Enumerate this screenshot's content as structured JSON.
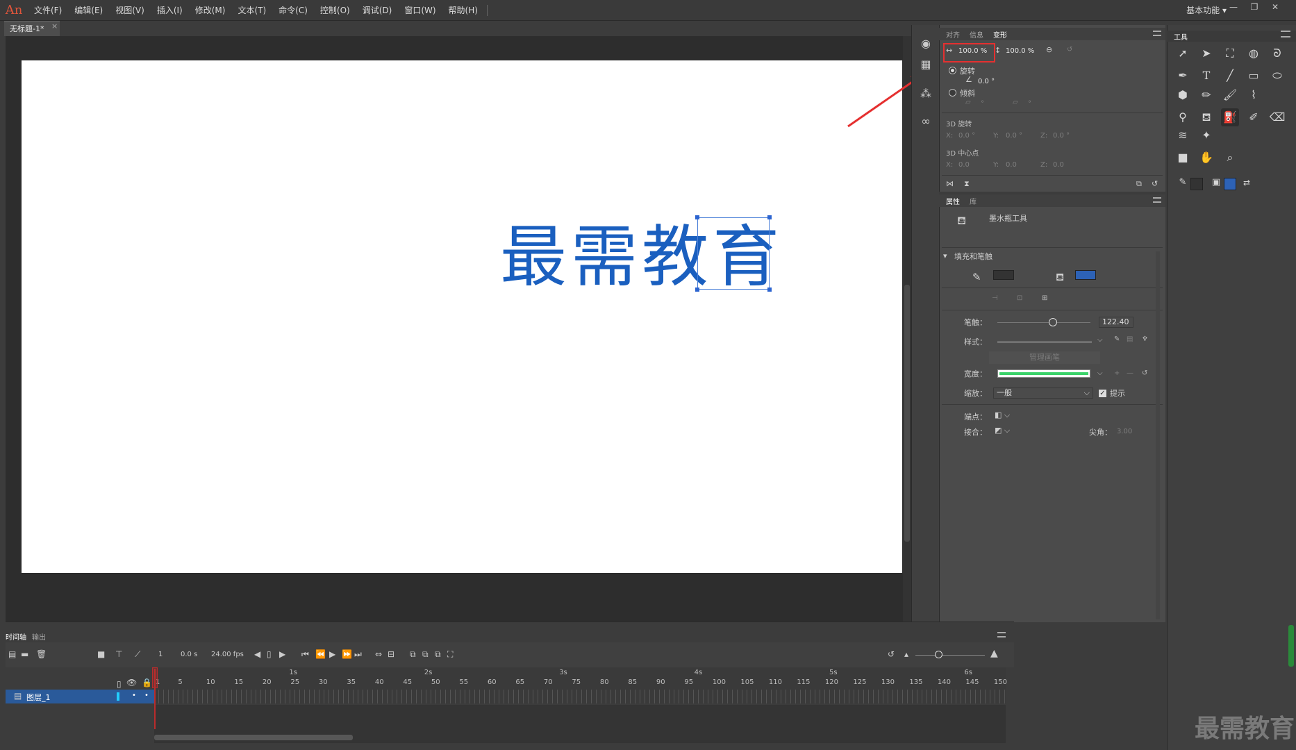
{
  "app": {
    "logo": "An",
    "workspace": "基本功能"
  },
  "menu": {
    "items": [
      "文件(F)",
      "编辑(E)",
      "视图(V)",
      "插入(I)",
      "修改(M)",
      "文本(T)",
      "命令(C)",
      "控制(O)",
      "调试(D)",
      "窗口(W)",
      "帮助(H)"
    ]
  },
  "document": {
    "tab_title": "无标题-1*",
    "close": "×"
  },
  "stage": {
    "text": "最需教育",
    "text_color": "#1a5fbf"
  },
  "transform_panel": {
    "tabs": [
      "对齐",
      "信息",
      "变形"
    ],
    "width_pct": "100.0 %",
    "height_pct": "100.0 %",
    "rotate_label": "旋转",
    "rotate_value": "0.0 °",
    "skew_label": "倾斜",
    "skew_x": "°",
    "skew_y": "°",
    "rotate3d_label": "3D 旋转",
    "rotate3d": {
      "x_label": "X:",
      "x": "0.0 °",
      "y_label": "Y:",
      "y": "0.0 °",
      "z_label": "Z:",
      "z": "0.0 °"
    },
    "center3d_label": "3D 中心点",
    "center3d": {
      "x_label": "X:",
      "x": "0.0",
      "y_label": "Y:",
      "y": "0.0",
      "z_label": "Z:",
      "z": "0.0"
    }
  },
  "properties_panel": {
    "tabs": [
      "属性",
      "库"
    ],
    "tool_name": "墨水瓶工具",
    "section": "填充和笔触",
    "stroke_color": "#333333",
    "fill_color": "#2d62b6",
    "stroke_label": "笔触：",
    "stroke_value": "122.40",
    "style_label": "样式：",
    "manage_brush": "管理画笔",
    "width_label": "宽度：",
    "scale_label": "缩放：",
    "scale_value": "一般",
    "hint_label": "提示",
    "cap_label": "端点：",
    "join_label": "接合：",
    "miter_label": "尖角：",
    "miter_value": "3.00"
  },
  "tools_panel": {
    "title": "工具"
  },
  "timeline": {
    "tabs": [
      "时间轴",
      "输出"
    ],
    "frame": "1",
    "time": "0.0 s",
    "fps": "24.00 fps",
    "layer_name": "图层_1",
    "seconds": [
      "1s",
      "2s",
      "3s",
      "4s",
      "5s",
      "6s"
    ],
    "frame_ticks": [
      "1",
      "5",
      "10",
      "15",
      "20",
      "25",
      "30",
      "35",
      "40",
      "45",
      "50",
      "55",
      "60",
      "65",
      "70",
      "75",
      "80",
      "85",
      "90",
      "95",
      "100",
      "105",
      "110",
      "115",
      "120",
      "125",
      "130",
      "135",
      "140",
      "145",
      "150"
    ]
  },
  "watermark": "最需教育"
}
